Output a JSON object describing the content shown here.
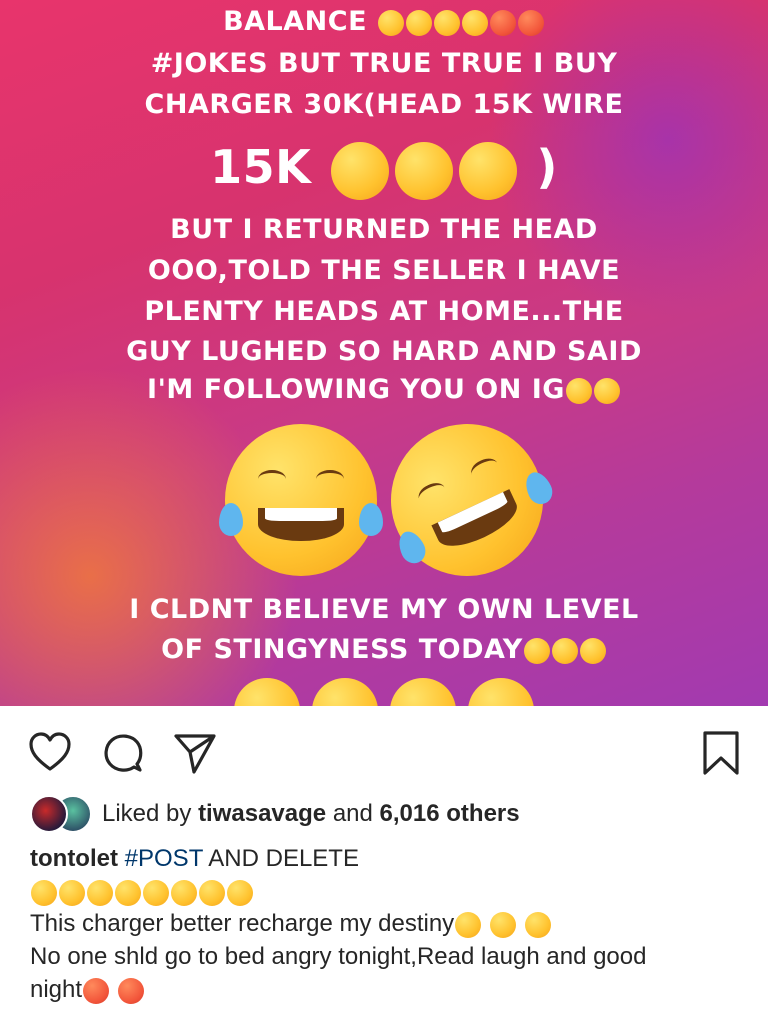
{
  "story": {
    "lines": [
      "BALANCE",
      "#JOKES BUT TRUE TRUE I BUY",
      "CHARGER 30K(HEAD 15K WIRE",
      "15K",
      ")",
      "BUT I RETURNED THE HEAD",
      "OOO,TOLD THE SELLER I HAVE",
      "PLENTY HEADS AT HOME...THE",
      "GUY LUGHED SO HARD AND SAID",
      "I'M FOLLOWING YOU ON IG",
      "I CLDNT BELIEVE MY OWN LEVEL",
      "OF STINGYNESS TODAY"
    ]
  },
  "actions": {
    "like": "heart-icon",
    "comment": "comment-icon",
    "share": "share-icon",
    "save": "bookmark-icon"
  },
  "likes": {
    "prefix": "Liked by",
    "user": "tiwasavage",
    "middle": "and",
    "count": "6,016 others"
  },
  "caption": {
    "user": "tontolet",
    "hashtag": "#POST",
    "text1": "AND DELETE",
    "line2": "This charger better recharge my destiny",
    "line3": "No one shld go to bed angry tonight,Read laugh and good",
    "line4": "night"
  },
  "colors": {
    "accent_link": "#00376b",
    "text": "#262626"
  }
}
